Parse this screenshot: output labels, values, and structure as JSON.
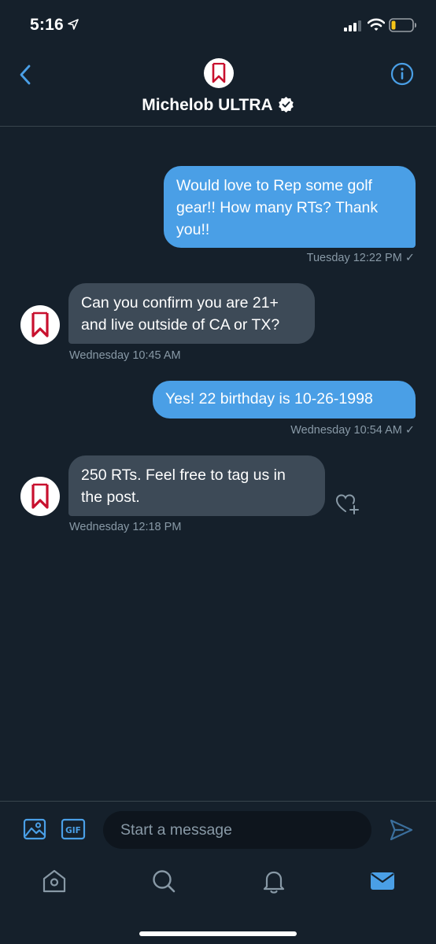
{
  "status_bar": {
    "time": "5:16",
    "icons": [
      "location-arrow-icon",
      "cellular-signal-icon",
      "wifi-icon",
      "battery-low-icon"
    ]
  },
  "header": {
    "contact_name": "Michelob ULTRA",
    "verified": true,
    "back_icon": "chevron-left-icon",
    "info_icon": "info-icon"
  },
  "messages": [
    {
      "direction": "outgoing",
      "text_lines": [
        "Would love to Rep some golf",
        "gear!! How many RTs? Thank",
        "you!!"
      ],
      "timestamp": "Tuesday 12:22 PM ✓"
    },
    {
      "direction": "incoming",
      "text_lines": [
        "Can you confirm you are 21+",
        "and live outside of CA or TX?"
      ],
      "timestamp": "Wednesday 10:45 AM"
    },
    {
      "direction": "outgoing",
      "text_lines": [
        "Yes! 22 birthday is 10-26-1998"
      ],
      "timestamp": "Wednesday 10:54 AM ✓"
    },
    {
      "direction": "incoming",
      "text_lines": [
        "250 RTs. Feel free to tag us in",
        "the post."
      ],
      "timestamp": "Wednesday 12:18 PM"
    }
  ],
  "composer": {
    "placeholder": "Start a message",
    "value": "",
    "icons": [
      "image-icon",
      "gif-icon",
      "send-icon"
    ]
  },
  "tab_bar": {
    "tabs": [
      "home-icon",
      "search-icon",
      "notifications-bell-icon",
      "messages-mail-icon"
    ],
    "active": "messages-mail-icon"
  },
  "colors": {
    "background": "#15202b",
    "accent": "#4a9fe6",
    "incoming_bubble": "#3d4a57",
    "secondary_text": "#8899a6",
    "brand_red": "#c8102e"
  }
}
